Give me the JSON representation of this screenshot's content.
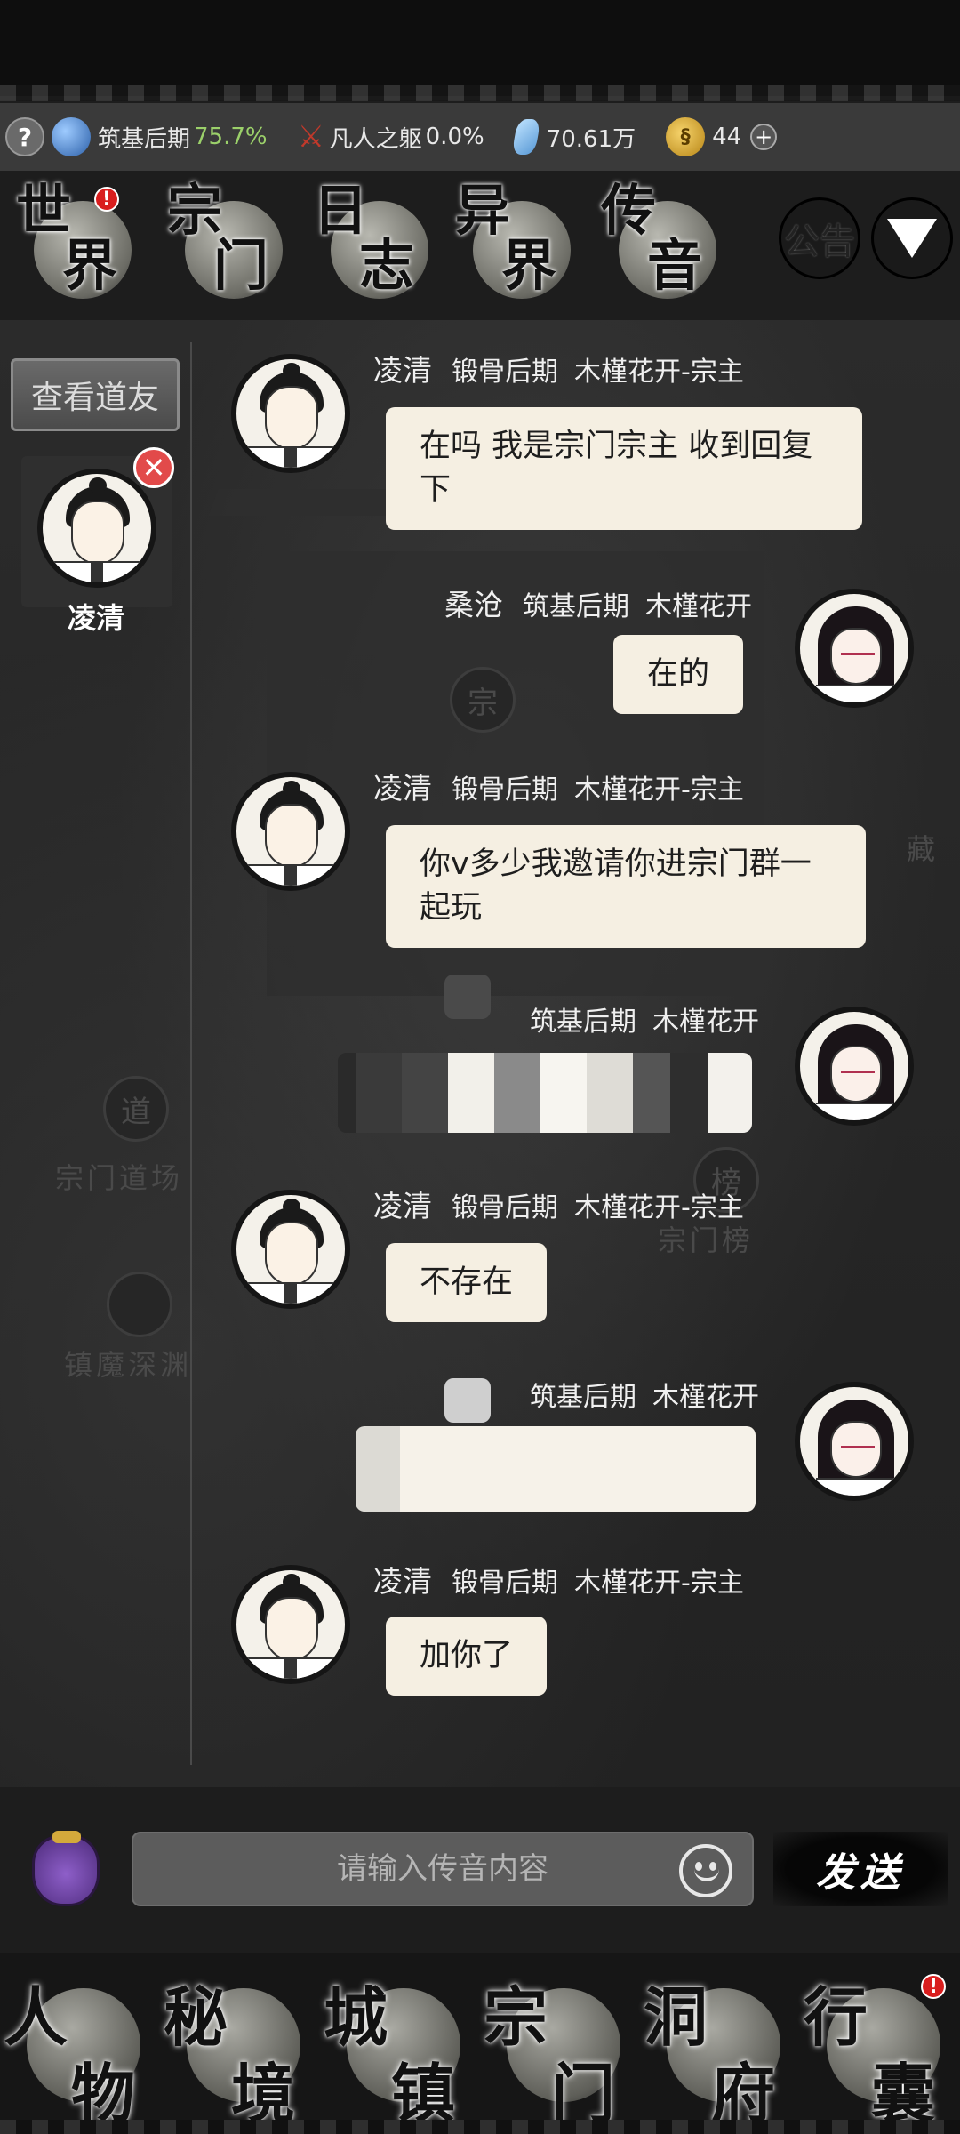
{
  "status": {
    "realm": "筑基后期",
    "realm_progress": "75.7%",
    "body": "凡人之躯",
    "body_progress": "0.0%",
    "spirit_stones": "70.61万",
    "coins": "44"
  },
  "top_nav": [
    {
      "c1": "世",
      "c2": "界",
      "badge": "!"
    },
    {
      "c1": "宗",
      "c2": "门"
    },
    {
      "c1": "日",
      "c2": "志"
    },
    {
      "c1": "异",
      "c2": "界"
    },
    {
      "c1": "传",
      "c2": "音"
    }
  ],
  "top_right": {
    "announce_a": "公",
    "announce_b": "告",
    "log_a": "日",
    "log_b": "志"
  },
  "left_pane": {
    "view_button": "查看道友",
    "friend_name": "凌清"
  },
  "messages": [
    {
      "name": "凌清",
      "rank": "锻骨后期",
      "sect": "木槿花开-宗主",
      "text": "在吗 我是宗门宗主 收到回复下"
    },
    {
      "name": "桑沧",
      "rank": "筑基后期",
      "sect": "木槿花开",
      "text": "在的"
    },
    {
      "name": "凌清",
      "rank": "锻骨后期",
      "sect": "木槿花开-宗主",
      "text": "你v多少我邀请你进宗门群一起玩"
    },
    {
      "rank": "筑基后期",
      "sect": "木槿花开"
    },
    {
      "name": "凌清",
      "rank": "锻骨后期",
      "sect": "木槿花开-宗主",
      "text": "不存在"
    },
    {
      "rank": "筑基后期",
      "sect": "木槿花开"
    },
    {
      "name": "凌清",
      "rank": "锻骨后期",
      "sect": "木槿花开-宗主",
      "text": "加你了"
    }
  ],
  "input": {
    "placeholder": "请输入传音内容",
    "send_label": "发送"
  },
  "bottom_nav": [
    {
      "c1": "人",
      "c2": "物"
    },
    {
      "c1": "秘",
      "c2": "境"
    },
    {
      "c1": "城",
      "c2": "镇"
    },
    {
      "c1": "宗",
      "c2": "门"
    },
    {
      "c1": "洞",
      "c2": "府"
    },
    {
      "c1": "行",
      "c2": "囊",
      "badge": "!"
    }
  ],
  "colors": {
    "bubble": "#f5efe2",
    "accent_green": "#9bd06a",
    "badge_red": "#d91e1e"
  }
}
